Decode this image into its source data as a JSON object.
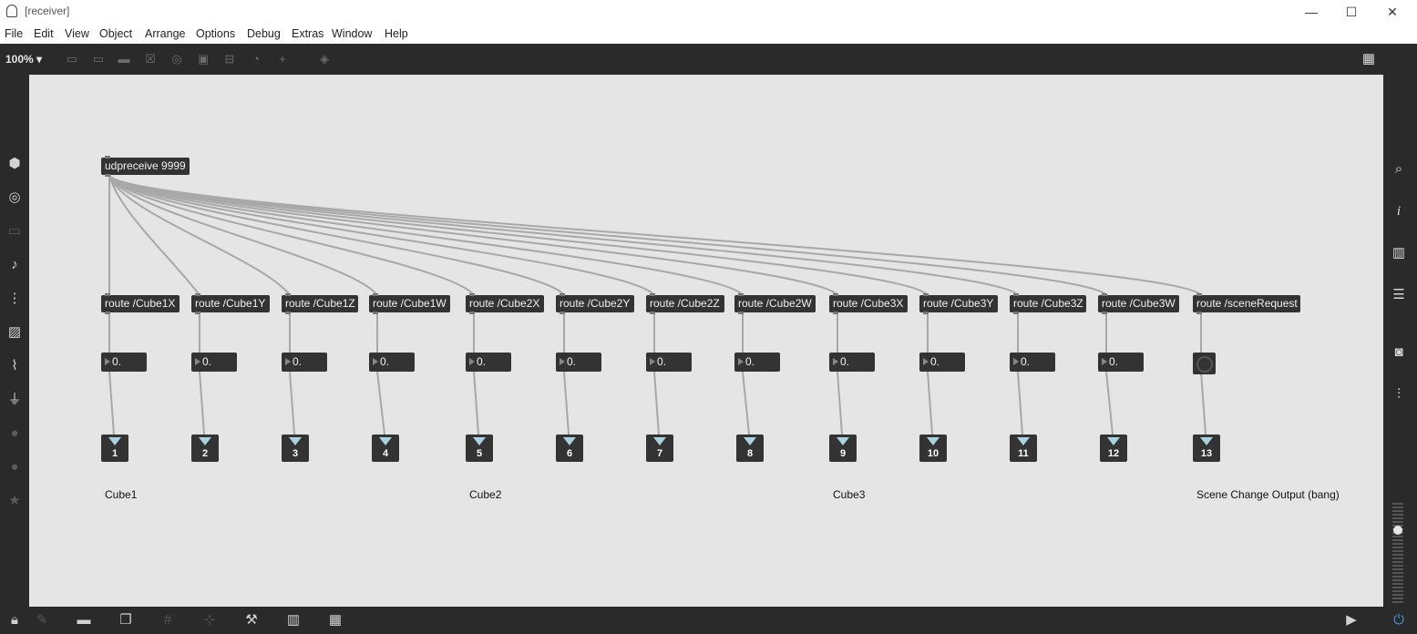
{
  "window": {
    "title": "[receiver]",
    "controls": [
      "—",
      "☐",
      "✕"
    ]
  },
  "menu": [
    "File",
    "Edit",
    "View",
    "Object",
    "Arrange",
    "Options",
    "Debug",
    "Extras",
    "Window",
    "Help"
  ],
  "toolbar": {
    "zoom": "100%"
  },
  "patch": {
    "udp_object": "udpreceive 9999",
    "routes": [
      "route /Cube1X",
      "route /Cube1Y",
      "route /Cube1Z",
      "route /Cube1W",
      "route /Cube2X",
      "route /Cube2Y",
      "route /Cube2Z",
      "route /Cube2W",
      "route /Cube3X",
      "route /Cube3Y",
      "route /Cube3Z",
      "route /Cube3W",
      "route /sceneRequest"
    ],
    "number_value": "0.",
    "outlets": [
      "1",
      "2",
      "3",
      "4",
      "5",
      "6",
      "7",
      "8",
      "9",
      "10",
      "11",
      "12",
      "13"
    ],
    "comments": [
      "Cube1",
      "Cube2",
      "Cube3",
      "Scene Change Output (bang)"
    ]
  },
  "icons": {
    "left": [
      "cube-icon",
      "target-icon",
      "film-icon",
      "music-note-icon",
      "sequence-icon",
      "image-icon",
      "paperclip-icon",
      "plug-icon",
      "p-icon",
      "b-icon",
      "star-icon"
    ],
    "right": [
      "search-icon",
      "info-icon",
      "book-icon",
      "list-icon",
      "camera-icon",
      "sliders-icon"
    ],
    "bottom": [
      "lock-icon",
      "edit-mode-icon",
      "presentation-icon",
      "windows-icon",
      "grid-icon",
      "snap-icon",
      "wrench-icon",
      "piano-icon",
      "keyboard-icon",
      "play-icon",
      "power-icon"
    ]
  },
  "colors": {
    "canvas": "#e5e5e5",
    "object": "#333333",
    "chrome": "#2a2a2a",
    "outlet_arrow": "#a9d3e0"
  }
}
